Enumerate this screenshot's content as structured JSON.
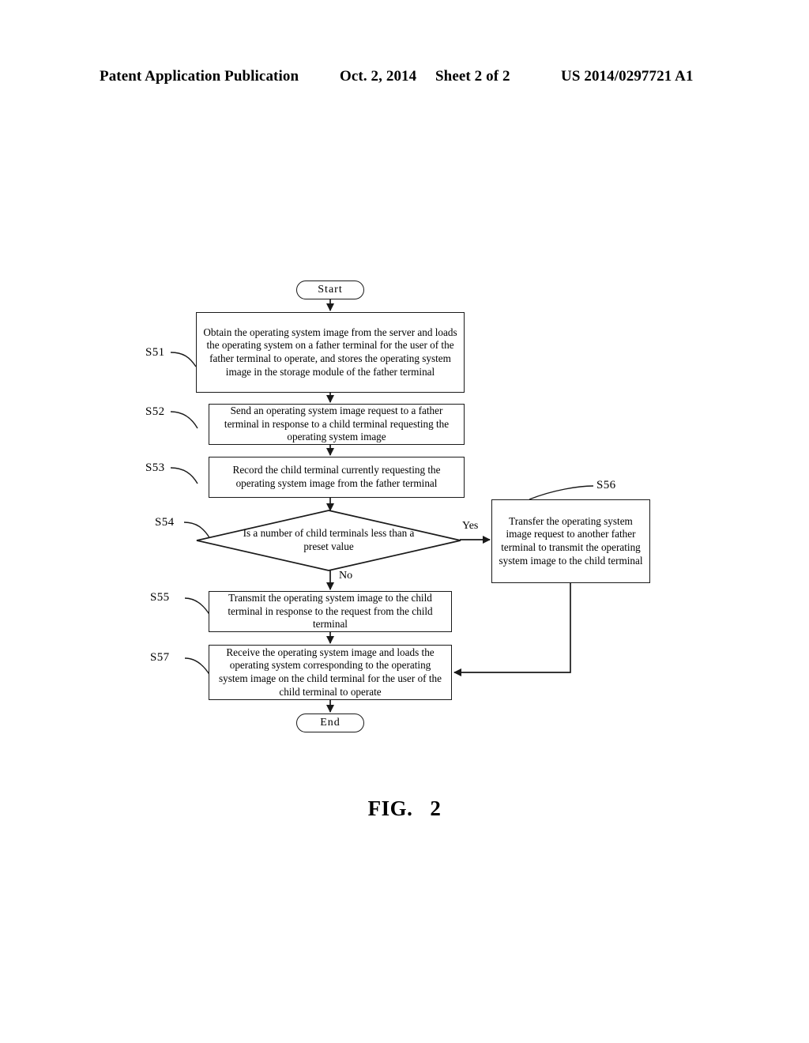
{
  "header": {
    "publication": "Patent Application Publication",
    "date": "Oct. 2, 2014",
    "sheet": "Sheet 2 of 2",
    "number": "US 2014/0297721 A1"
  },
  "figure": {
    "caption_word": "FIG.",
    "caption_number": "2"
  },
  "chart_data": {
    "type": "diagram",
    "subtype": "flowchart",
    "title": "FIG. 2",
    "nodes": [
      {
        "id": "start",
        "shape": "terminator",
        "label": "Start",
        "ref": ""
      },
      {
        "id": "s51",
        "shape": "process",
        "ref": "S51",
        "label": "Obtain the operating system image from the server and loads the operating system on a father terminal for the user of the father terminal to operate, and stores the operating system image in the storage module of the father terminal"
      },
      {
        "id": "s52",
        "shape": "process",
        "ref": "S52",
        "label": "Send an operating system image request to a father terminal in response to a child terminal requesting the operating system image"
      },
      {
        "id": "s53",
        "shape": "process",
        "ref": "S53",
        "label": "Record the child terminal currently requesting the operating system image from the father terminal"
      },
      {
        "id": "s54",
        "shape": "decision",
        "ref": "S54",
        "label": "Is a number of child terminals less than a preset value"
      },
      {
        "id": "s56",
        "shape": "process",
        "ref": "S56",
        "label": "Transfer the operating system image request to another father terminal to transmit the operating system image to the child terminal"
      },
      {
        "id": "s55",
        "shape": "process",
        "ref": "S55",
        "label": "Transmit the operating system image to the child terminal in response to the request from the child terminal"
      },
      {
        "id": "s57",
        "shape": "process",
        "ref": "S57",
        "label": "Receive the operating system image and loads the operating system corresponding to the operating system image on the child terminal for the user of the child terminal to operate"
      },
      {
        "id": "end",
        "shape": "terminator",
        "label": "End",
        "ref": ""
      }
    ],
    "edges": [
      {
        "from": "start",
        "to": "s51",
        "label": ""
      },
      {
        "from": "s51",
        "to": "s52",
        "label": ""
      },
      {
        "from": "s52",
        "to": "s53",
        "label": ""
      },
      {
        "from": "s53",
        "to": "s54",
        "label": ""
      },
      {
        "from": "s54",
        "to": "s56",
        "label": "Yes"
      },
      {
        "from": "s54",
        "to": "s55",
        "label": "No"
      },
      {
        "from": "s55",
        "to": "s57",
        "label": ""
      },
      {
        "from": "s56",
        "to": "s57",
        "label": ""
      },
      {
        "from": "s57",
        "to": "end",
        "label": ""
      }
    ]
  },
  "flowchart": {
    "start_label": "Start",
    "end_label": "End",
    "yes_label": "Yes",
    "no_label": "No",
    "refs": {
      "s51": "S51",
      "s52": "S52",
      "s53": "S53",
      "s54": "S54",
      "s55": "S55",
      "s56": "S56",
      "s57": "S57"
    },
    "steps": {
      "s51": "Obtain the operating system image from the server and loads the operating system on a father terminal for the user of the father terminal to operate, and stores the operating system image in the storage module of the father terminal",
      "s52": "Send an operating system image request to a father terminal in response to a child terminal requesting the operating system image",
      "s53": "Record the child terminal currently requesting the operating system image from the father terminal",
      "s54": "Is a number of child terminals less than a preset value",
      "s55": "Transmit the operating system image to the child terminal in response to the request from the child terminal",
      "s56": "Transfer the operating system image request to another father terminal to transmit the operating system image to the child terminal",
      "s57": "Receive the operating system image and loads the operating system corresponding to the operating system image on the child terminal for the user of the child terminal to operate"
    }
  },
  "colors": {
    "ink": "#1a1a1a",
    "page": "#ffffff"
  }
}
